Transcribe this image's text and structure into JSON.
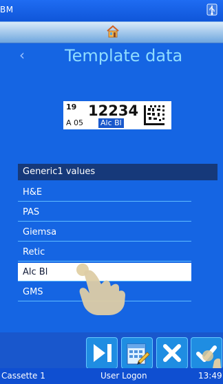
{
  "app": {
    "short": "BM"
  },
  "header": {
    "title": "Template data"
  },
  "label_preview": {
    "line_1_small": "19",
    "line_1_big": "12234",
    "line_2_left": "A   05",
    "line_2_highlight": "Alc Bl"
  },
  "list": {
    "header": "Generic1 values",
    "items": [
      {
        "label": "H&E",
        "selected": false
      },
      {
        "label": "PAS",
        "selected": false
      },
      {
        "label": "Giemsa",
        "selected": false
      },
      {
        "label": "Retic",
        "selected": false
      },
      {
        "label": "Alc Bl",
        "selected": true
      },
      {
        "label": "GMS",
        "selected": false
      }
    ]
  },
  "status": {
    "left": "Cassette 1",
    "center": "User Logon",
    "right": "13:49"
  },
  "colors": {
    "background": "#1565e3",
    "title": "#8fdcff",
    "list_divider": "#5ebcff",
    "button_blue": "#1f8de2",
    "selected_row": "#ffffff"
  },
  "icons": {
    "usb": "usb-icon",
    "home": "home-icon",
    "back": "chevron-left-icon",
    "datamatrix": "datamatrix-icon",
    "next": "next-track-icon",
    "edit": "label-edit-icon",
    "cancel": "close-icon",
    "confirm": "check-icon",
    "touch": "pointer-hand-icon"
  }
}
